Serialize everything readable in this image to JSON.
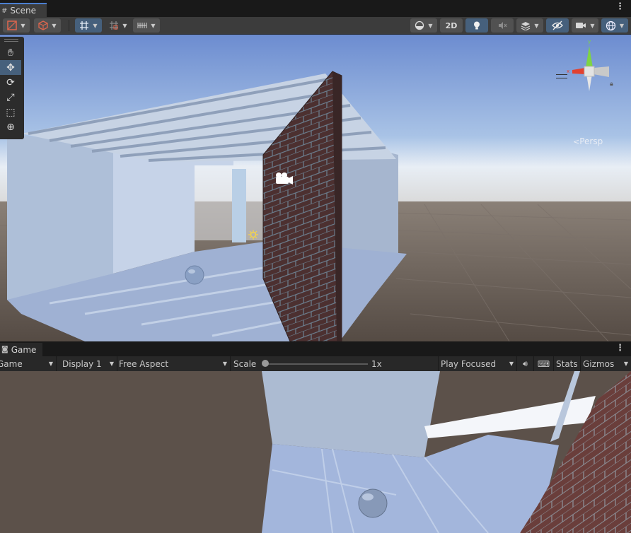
{
  "scene_panel": {
    "tab_label": "Scene",
    "tab_icon": "hash-icon",
    "toolbar": {
      "btn_2d_label": "2D"
    },
    "tools": [
      "hand-tool-icon",
      "move-tool-icon",
      "rotate-tool-icon",
      "scale-tool-icon",
      "rect-tool-icon",
      "transform-tool-icon"
    ],
    "gizmo": {
      "projection_label": "Persp",
      "axis_x_label": "x",
      "axis_y_label": "y"
    }
  },
  "game_panel": {
    "tab_label": "Game",
    "toolbar": {
      "mode_label": "Game",
      "display_label": "Display 1",
      "aspect_label": "Free Aspect",
      "scale_label": "Scale",
      "scale_value": "1x",
      "play_mode_label": "Play Focused",
      "stats_label": "Stats",
      "gizmos_label": "Gizmos"
    }
  },
  "colors": {
    "active_button": "#46607c",
    "toolbar_bg": "#3c3c3c",
    "sky_top": "#6f8fd0",
    "ground": "#5a514a",
    "brick": "#4f3232",
    "gizmo_x": "#e2412f",
    "gizmo_y": "#8bd94a"
  }
}
